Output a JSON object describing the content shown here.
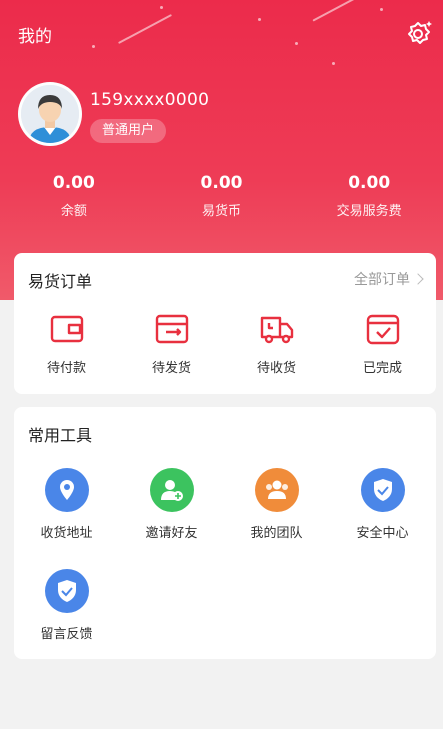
{
  "header": {
    "title": "我的"
  },
  "user": {
    "phone": "159xxxx0000",
    "level": "普通用户"
  },
  "stats": [
    {
      "value": "0.00",
      "label": "余额"
    },
    {
      "value": "0.00",
      "label": "易货币"
    },
    {
      "value": "0.00",
      "label": "交易服务费"
    }
  ],
  "orders": {
    "title": "易货订单",
    "all_label": "全部订单",
    "items": [
      {
        "label": "待付款",
        "icon": "wallet-icon"
      },
      {
        "label": "待发货",
        "icon": "box-icon"
      },
      {
        "label": "待收货",
        "icon": "truck-icon"
      },
      {
        "label": "已完成",
        "icon": "check-box-icon"
      }
    ]
  },
  "tools": {
    "title": "常用工具",
    "items": [
      {
        "label": "收货地址",
        "icon": "location-icon",
        "color": "#4a86e8"
      },
      {
        "label": "邀请好友",
        "icon": "add-user-icon",
        "color": "#3cc35f"
      },
      {
        "label": "我的团队",
        "icon": "team-icon",
        "color": "#f08c3a"
      },
      {
        "label": "安全中心",
        "icon": "shield-icon",
        "color": "#4a86e8"
      },
      {
        "label": "留言反馈",
        "icon": "feedback-shield-icon",
        "color": "#4a86e8"
      }
    ]
  },
  "colors": {
    "brand": "#ec2b4b",
    "icon_red": "#e8303f"
  }
}
